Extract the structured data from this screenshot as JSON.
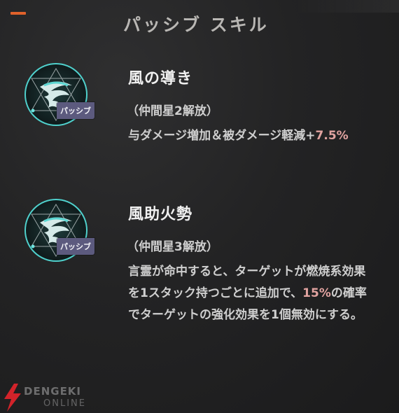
{
  "header": {
    "title": "パッシブ スキル"
  },
  "skills": [
    {
      "name": "風の導き",
      "badge": "パッシブ",
      "condition": "（仲間星2解放）",
      "desc_pre": "与ダメージ増加＆被ダメージ軽減+",
      "desc_highlight": "7.5%",
      "desc_post": ""
    },
    {
      "name": "風助火勢",
      "badge": "パッシブ",
      "condition": "（仲間星3解放）",
      "desc_pre": "言霊が命中すると、ターゲットが燃焼系効果を1スタック持つごとに追加で、",
      "desc_highlight": "15%",
      "desc_post": "の確率でターゲットの強化効果を1個無効にする。"
    }
  ],
  "watermark": {
    "brand": "DENGEKI",
    "sub": "ONLINE"
  },
  "colors": {
    "accent": "#e0622b",
    "badge": "#5c5a7e",
    "highlight": "#e1a3a0",
    "icon_teal": "#4fd0cc"
  },
  "icons": [
    "orange-accent-bar",
    "wind-skill-icon",
    "lightning-bolt-icon"
  ]
}
